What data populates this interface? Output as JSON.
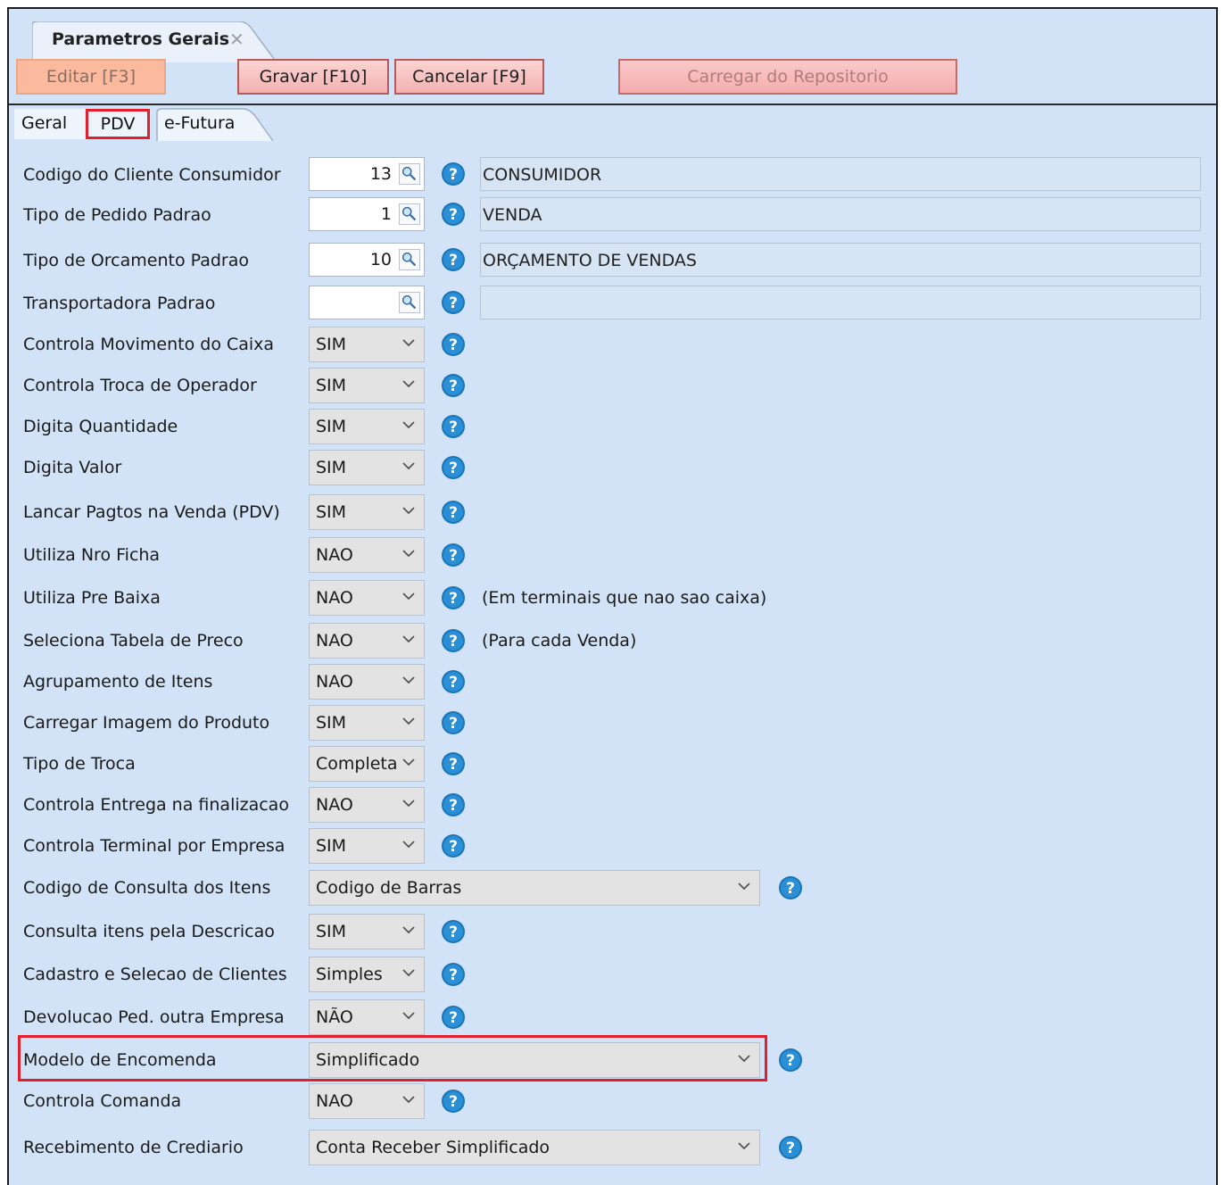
{
  "window": {
    "doc_tab_title": "Parametros Gerais",
    "buttons": {
      "editar": "Editar [F3]",
      "gravar": "Gravar [F10]",
      "cancelar": "Cancelar [F9]",
      "carregar": "Carregar do Repositorio"
    },
    "tabs": [
      {
        "label": "Geral"
      },
      {
        "label": "PDV",
        "active": true
      },
      {
        "label": "e-Futura"
      }
    ]
  },
  "lookups": [
    {
      "label": "Codigo do Cliente Consumidor",
      "code": "13",
      "desc": "CONSUMIDOR"
    },
    {
      "label": "Tipo de Pedido Padrao",
      "code": "1",
      "desc": "VENDA"
    },
    {
      "label": "Tipo de Orcamento Padrao",
      "code": "10",
      "desc": "ORÇAMENTO DE VENDAS"
    },
    {
      "label": "Transportadora Padrao",
      "code": "",
      "desc": ""
    }
  ],
  "options": [
    {
      "label": "Controla Movimento do Caixa",
      "value": "SIM"
    },
    {
      "label": "Controla Troca de Operador",
      "value": "SIM"
    },
    {
      "label": "Digita Quantidade",
      "value": "SIM"
    },
    {
      "label": "Digita Valor",
      "value": "SIM"
    },
    {
      "label": "Lancar Pagtos na Venda (PDV)",
      "value": "SIM"
    },
    {
      "label": "Utiliza Nro Ficha",
      "value": "NAO"
    },
    {
      "label": "Utiliza Pre Baixa",
      "value": "NAO",
      "note": "(Em terminais que nao sao caixa)"
    },
    {
      "label": "Seleciona Tabela de Preco",
      "value": "NAO",
      "note": "(Para cada Venda)"
    },
    {
      "label": "Agrupamento de Itens",
      "value": "NAO"
    },
    {
      "label": "Carregar Imagem do Produto",
      "value": "SIM"
    },
    {
      "label": "Tipo de Troca",
      "value": "Completa"
    },
    {
      "label": "Controla Entrega na finalizacao",
      "value": "NAO"
    },
    {
      "label": "Controla Terminal por Empresa",
      "value": "SIM"
    },
    {
      "label": "Codigo de Consulta dos Itens",
      "value": "Codigo de Barras",
      "wide": true
    },
    {
      "label": "Consulta itens pela Descricao",
      "value": "SIM"
    },
    {
      "label": "Cadastro e Selecao de Clientes",
      "value": "Simples"
    },
    {
      "label": "Devolucao Ped. outra Empresa",
      "value": "NÃO"
    },
    {
      "label": "Modelo de Encomenda",
      "value": "Simplificado",
      "wide": true,
      "highlight": true
    },
    {
      "label": "Controla Comanda",
      "value": "NAO"
    },
    {
      "label": "Recebimento de Crediario",
      "value": "Conta Receber Simplificado",
      "wide": true
    }
  ],
  "colors": {
    "highlight": "#e0202c",
    "help": "#1a75b8"
  }
}
